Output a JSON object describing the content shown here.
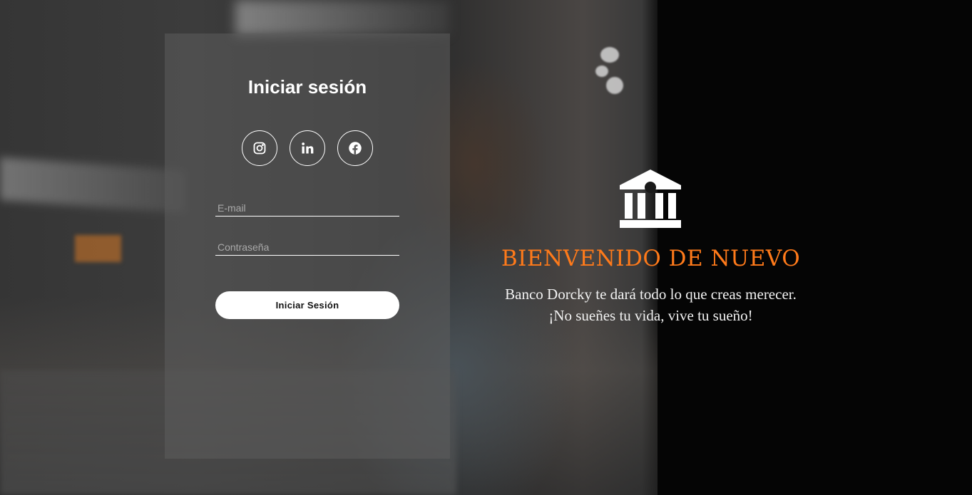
{
  "login": {
    "title": "Iniciar sesión",
    "social": [
      {
        "name": "instagram-icon"
      },
      {
        "name": "linkedin-icon"
      },
      {
        "name": "facebook-icon"
      }
    ],
    "email_placeholder": "E-mail",
    "password_placeholder": "Contraseña",
    "submit_label": "Iniciar Sesión"
  },
  "welcome": {
    "icon": "bank-icon",
    "title": "BIENVENIDO DE NUEVO",
    "line1": "Banco Dorcky te dará todo lo que creas merecer.",
    "line2": "¡No sueñes tu vida, vive tu sueño!"
  },
  "colors": {
    "accent": "#ff7a1a",
    "card_bg": "rgba(92,92,92,0.55)",
    "button_bg": "#ffffff"
  }
}
